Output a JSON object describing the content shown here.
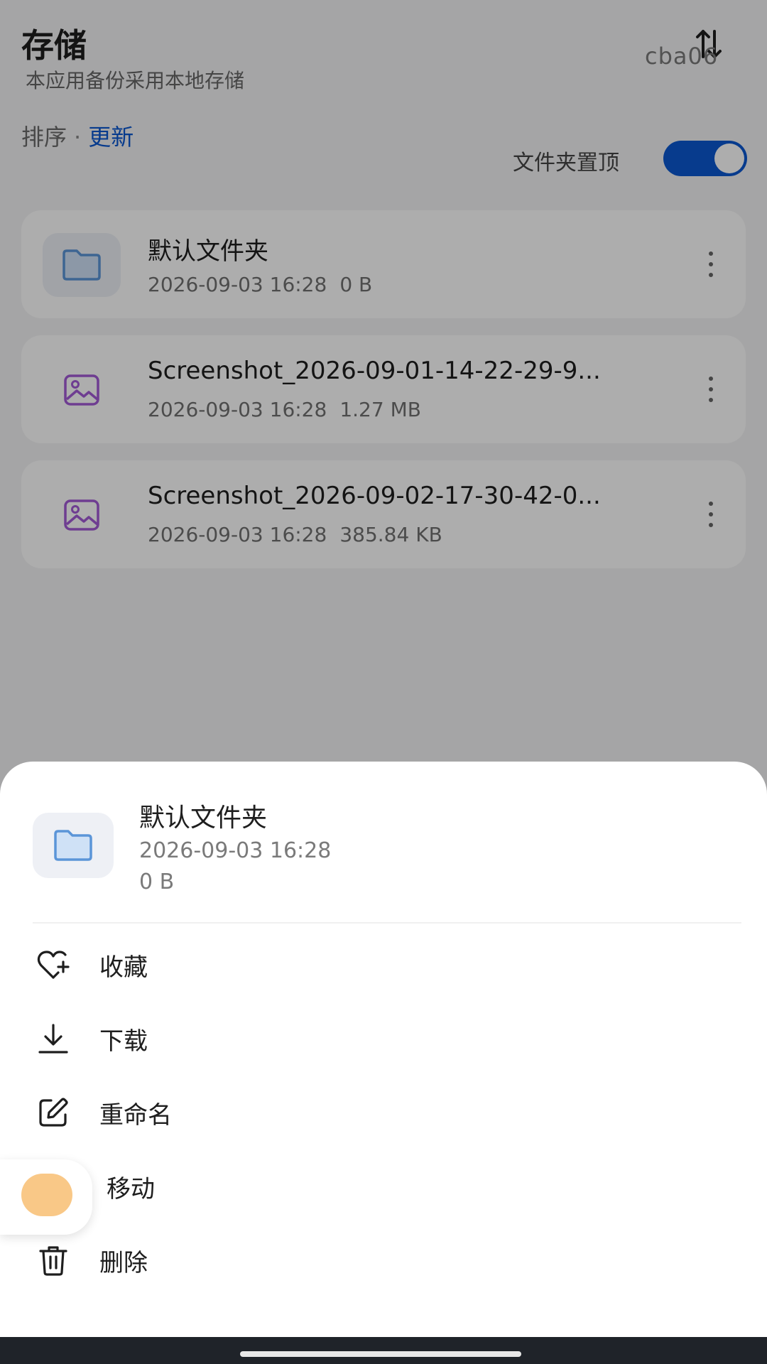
{
  "header": {
    "title": "存储",
    "subtitle": "本应用备份采用本地存储",
    "watermark": "cba06"
  },
  "sort": {
    "label": "排序",
    "separator": "·",
    "active": "更新"
  },
  "pin_folders": {
    "label": "文件夹置顶",
    "enabled": true
  },
  "files": [
    {
      "name": "默认文件夹",
      "time": "2026-09-03 16:28",
      "size": "0 B",
      "icon": "folder-icon"
    },
    {
      "name": "Screenshot_2026-09-01-14-22-29-9...",
      "time": "2026-09-03 16:28",
      "size": "1.27 MB",
      "icon": "image-icon"
    },
    {
      "name": "Screenshot_2026-09-02-17-30-42-0...",
      "time": "2026-09-03 16:28",
      "size": "385.84 KB",
      "icon": "image-icon"
    }
  ],
  "sheet": {
    "name": "默认文件夹",
    "time": "2026-09-03 16:28",
    "size": "0 B",
    "actions": [
      {
        "label": "收藏",
        "icon": "heart-plus-icon"
      },
      {
        "label": "下载",
        "icon": "download-icon"
      },
      {
        "label": "重命名",
        "icon": "edit-icon"
      },
      {
        "label": "移动",
        "icon": "move-icon"
      },
      {
        "label": "删除",
        "icon": "trash-icon"
      }
    ]
  },
  "colors": {
    "accent": "#0b57d0",
    "folder_icon": "#5b95d8",
    "image_icon": "#a35ad6"
  }
}
